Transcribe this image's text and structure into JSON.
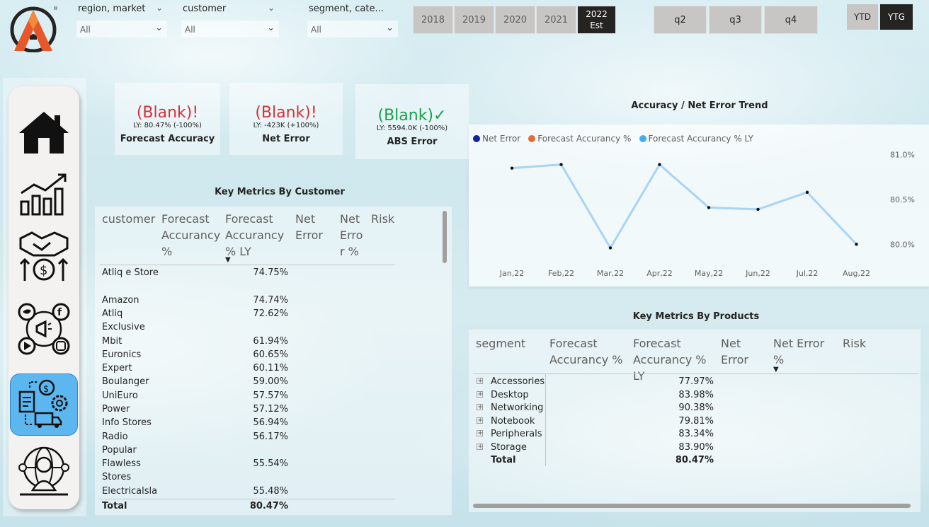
{
  "slicers": [
    {
      "title": "region, market",
      "value": "All"
    },
    {
      "title": "customer",
      "value": "All"
    },
    {
      "title": "segment, cate...",
      "value": "All"
    }
  ],
  "years": [
    "2018",
    "2019",
    "2020",
    "2021"
  ],
  "year_selected": {
    "line1": "2022",
    "line2": "Est"
  },
  "quarters": [
    "q2",
    "q3",
    "q4"
  ],
  "period_toggle": {
    "ytd": "YTD",
    "ytg": "YTG"
  },
  "nav_icons": [
    "home-icon",
    "growth-chart-icon",
    "handshake-finance-icon",
    "social-media-icon",
    "supply-chain-icon",
    "executive-globe-icon"
  ],
  "kpis": [
    {
      "value": "(Blank)",
      "mark": "!",
      "ly": "LY: 80.47% (-100%)",
      "label": "Forecast Accuracy",
      "color": "#d13438"
    },
    {
      "value": "(Blank)",
      "mark": "!",
      "ly": "LY: -423K (+100%)",
      "label": "Net Error",
      "color": "#d13438"
    },
    {
      "value": "(Blank)",
      "mark": "✓",
      "ly": "LY: 5594.0K (-100%)",
      "label": "ABS Error",
      "color": "#1aa14a"
    }
  ],
  "customer_table": {
    "title": "Key Metrics By Customer",
    "headers": [
      "customer",
      "Forecast Accurancy %",
      "Forecast Accurancy % LY",
      "Net Error",
      "Net Erro r %",
      "Risk"
    ],
    "rows": [
      {
        "customer": "Atliq e Store",
        "ly": "74.75%"
      },
      {
        "customer": "Amazon",
        "ly": "74.74%"
      },
      {
        "customer": "Atliq Exclusive",
        "ly": "72.62%"
      },
      {
        "customer": "Mbit",
        "ly": "61.94%"
      },
      {
        "customer": "Euronics",
        "ly": "60.65%"
      },
      {
        "customer": "Expert",
        "ly": "60.11%"
      },
      {
        "customer": "Boulanger",
        "ly": "59.00%"
      },
      {
        "customer": "UniEuro",
        "ly": "57.57%"
      },
      {
        "customer": "Power",
        "ly": "57.12%"
      },
      {
        "customer": "Info Stores",
        "ly": "56.94%"
      },
      {
        "customer": "Radio Popular",
        "ly": "56.17%"
      },
      {
        "customer": "Flawless Stores",
        "ly": "55.54%"
      },
      {
        "customer": "Electricalsla",
        "ly": "55.48%"
      }
    ],
    "total_label": "Total",
    "total_value": "80.47%"
  },
  "chart_data": {
    "type": "line",
    "title": "Accuracy / Net Error Trend",
    "legend": [
      {
        "name": "Net Error",
        "color": "#12239e"
      },
      {
        "name": "Forecast Accurancy %",
        "color": "#e66c37"
      },
      {
        "name": "Forecast Accurancy % LY",
        "color": "#4aa9f0"
      }
    ],
    "categories": [
      "Jan,22",
      "Feb,22",
      "Mar,22",
      "Apr,22",
      "May,22",
      "Jun,22",
      "Jul,22",
      "Aug,22"
    ],
    "series": [
      {
        "name": "Forecast Accurancy % LY",
        "values": [
          80.85,
          80.89,
          79.96,
          80.89,
          80.41,
          80.39,
          80.58,
          80.0
        ]
      }
    ],
    "y_ticks": [
      "81.0%",
      "80.5%",
      "80.0%"
    ],
    "ylim": [
      79.9,
      81.1
    ],
    "y_tick_values": [
      81.0,
      80.5,
      80.0
    ],
    "line_color": "#a9d4f5"
  },
  "product_table": {
    "title": "Key Metrics By Products",
    "headers": [
      "segment",
      "Forecast Accurancy %",
      "Forecast Accurancy % LY",
      "Net Error",
      "Net Error %",
      "Risk"
    ],
    "rows": [
      {
        "segment": "Accessories",
        "ly": "77.97%"
      },
      {
        "segment": "Desktop",
        "ly": "83.98%"
      },
      {
        "segment": "Networking",
        "ly": "90.38%"
      },
      {
        "segment": "Notebook",
        "ly": "79.81%"
      },
      {
        "segment": "Peripherals",
        "ly": "83.34%"
      },
      {
        "segment": "Storage",
        "ly": "83.90%"
      }
    ],
    "total_label": "Total",
    "total_value": "80.47%"
  }
}
